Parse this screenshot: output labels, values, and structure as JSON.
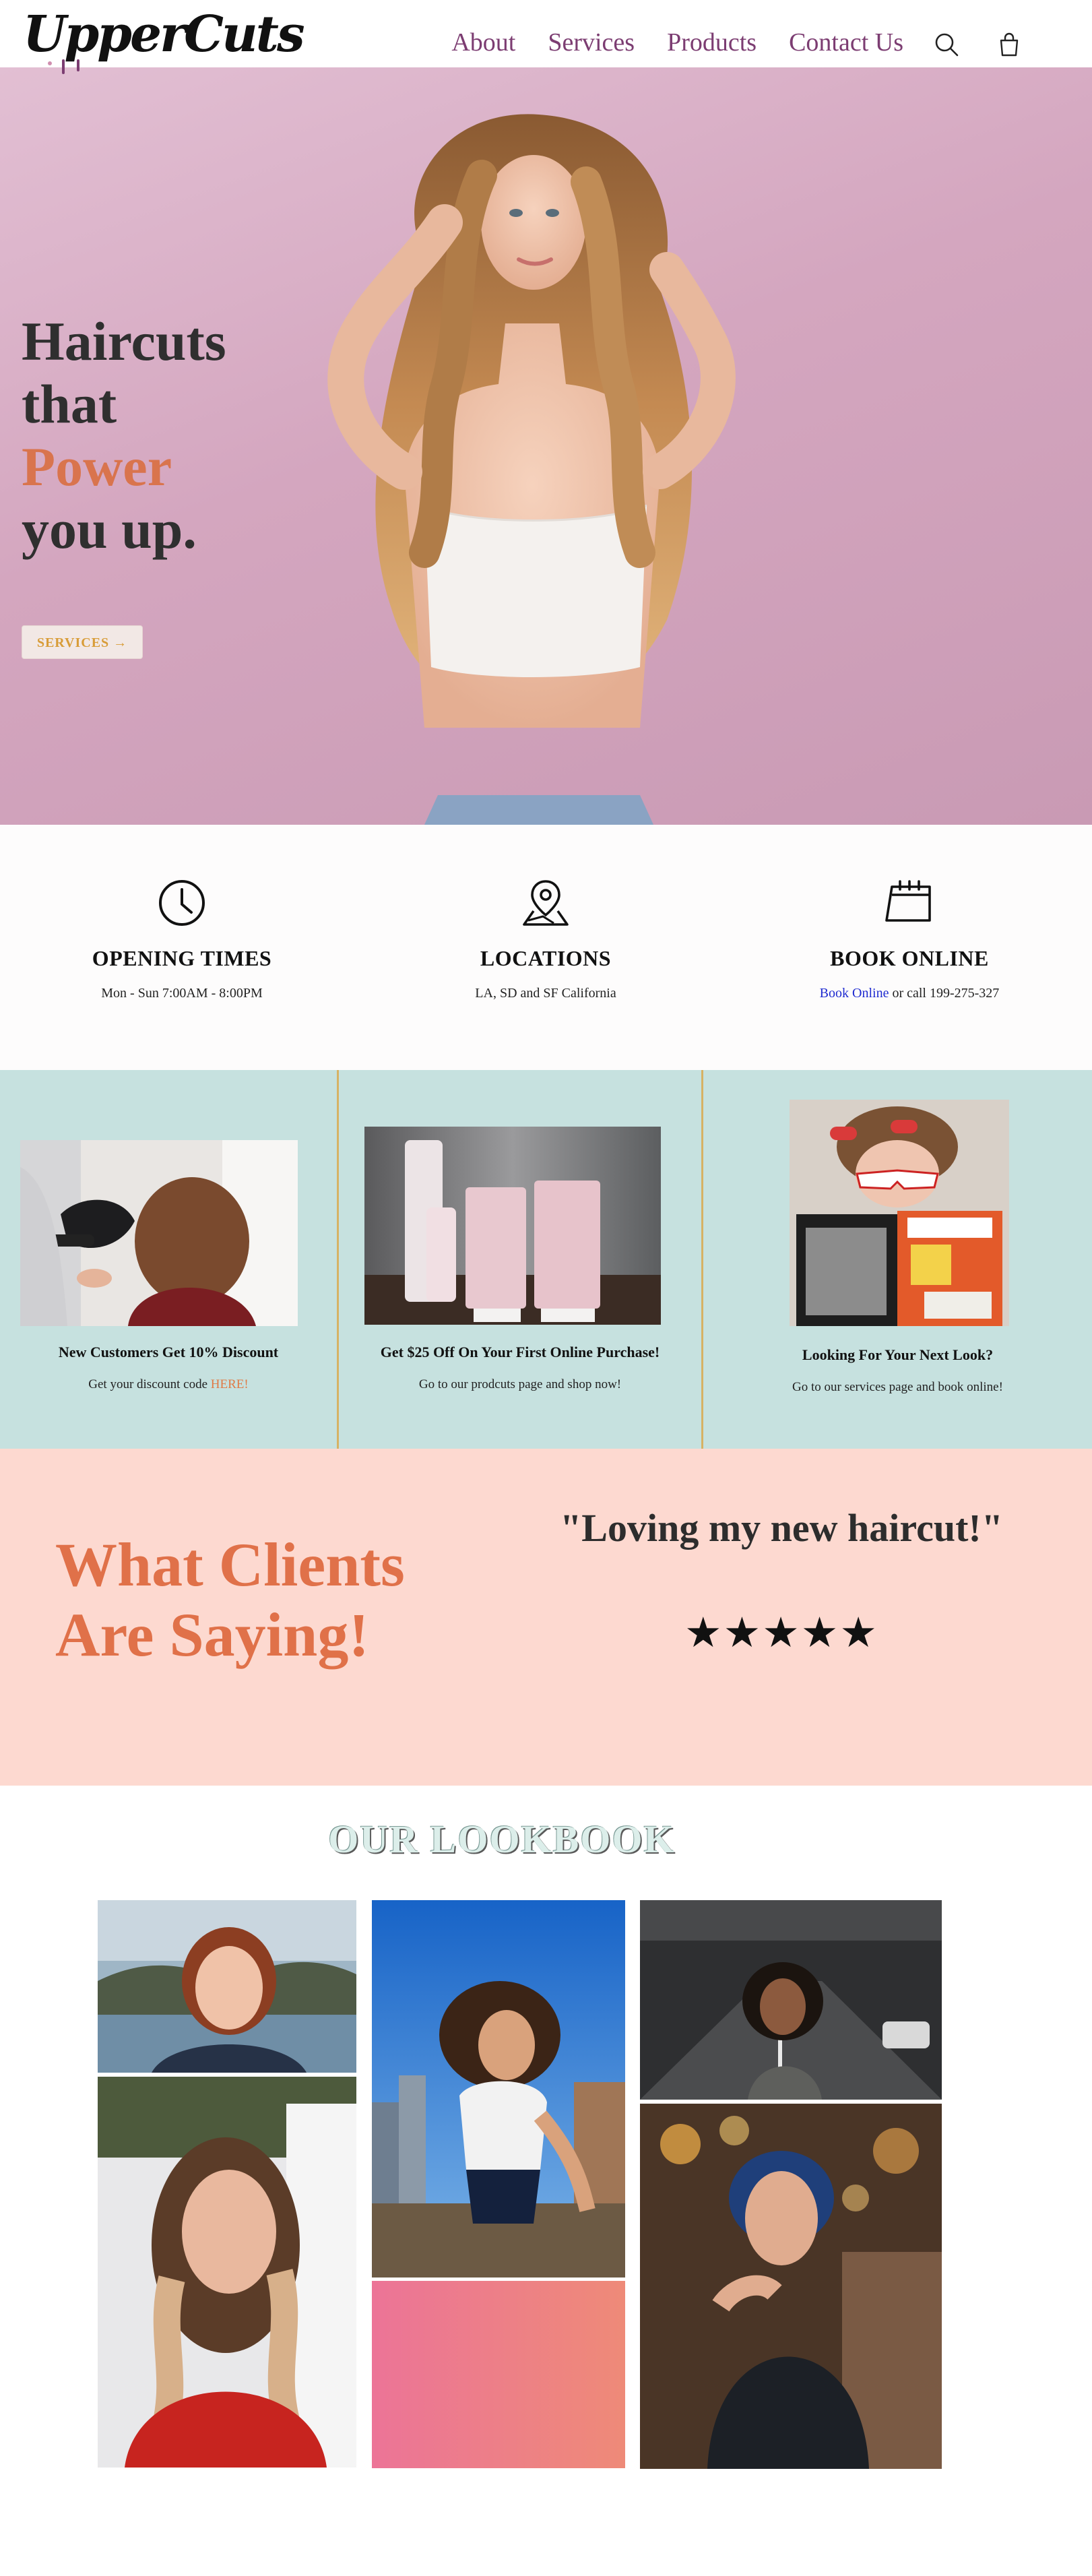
{
  "header": {
    "logo": "UpperCuts",
    "nav": [
      "About",
      "Services",
      "Products",
      "Contact Us"
    ],
    "icons": [
      "search-icon",
      "shopping-bag-icon"
    ]
  },
  "hero": {
    "title_line1": "Haircuts",
    "title_line2": "that",
    "title_accent": "Power",
    "title_line4": "you up.",
    "button_label": "SERVICES →"
  },
  "info": [
    {
      "icon": "clock-icon",
      "title": "OPENING TIMES",
      "text": "Mon - Sun 7:00AM - 8:00PM"
    },
    {
      "icon": "map-pin-icon",
      "title": "LOCATIONS",
      "text": "LA, SD and SF California"
    },
    {
      "icon": "calendar-icon",
      "title": "BOOK ONLINE",
      "link": "Book Online",
      "text_after": " or call 199-275-327"
    }
  ],
  "promos": [
    {
      "title": "New Customers Get 10% Discount",
      "text": "Get your discount code ",
      "link": "HERE!"
    },
    {
      "title": "Get $25 Off On Your First Online Purchase!",
      "text": "Go to our prodcuts page and shop now!"
    },
    {
      "title": "Looking For Your Next Look?",
      "text": "Go to our services page and book online!"
    }
  ],
  "testimonials": {
    "heading_line1": "What Clients",
    "heading_line2": "Are Saying!",
    "quote": "\"Loving my new haircut!\"",
    "stars": "★★★★★",
    "rating": 5
  },
  "lookbook": {
    "title": "OUR LOOKBOOK"
  },
  "colors": {
    "nav": "#7c3d72",
    "accent": "#d9744d",
    "promo_bg": "#c6e1df",
    "testimonial_bg": "#fdd9d0",
    "link_blue": "#1f2bd0"
  }
}
